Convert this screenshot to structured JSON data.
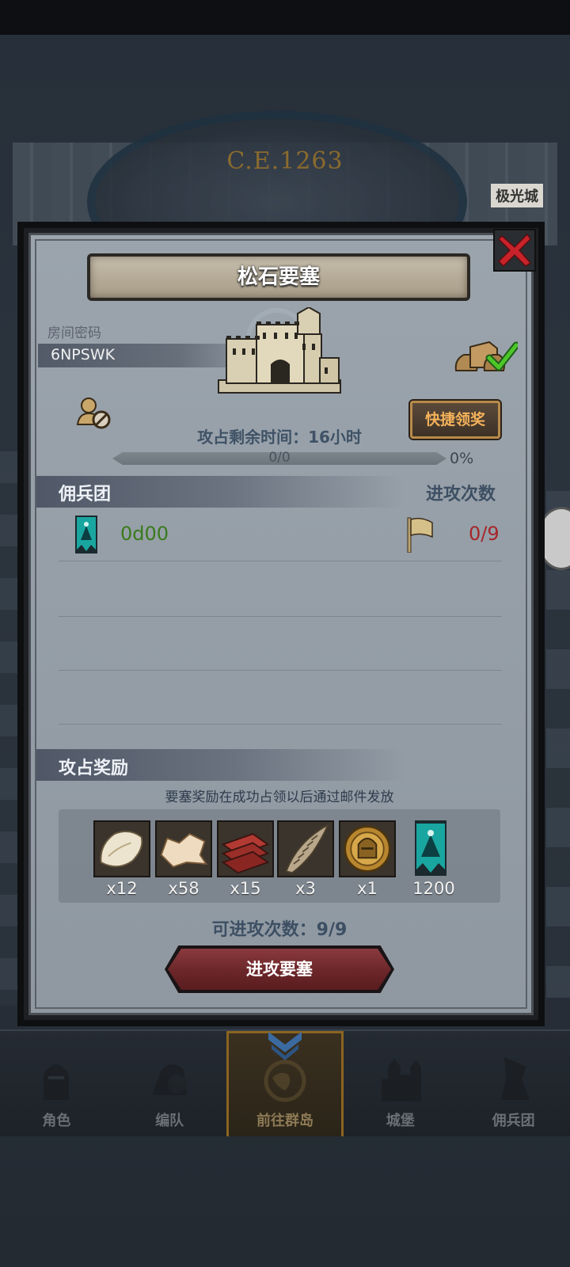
{
  "background": {
    "year_text": "C.E.1263",
    "place_label": "极光城"
  },
  "modal": {
    "title": "松石要塞",
    "room_code_label": "房间密码",
    "room_code": "6NPSWK",
    "quick_claim_label": "快捷领奖",
    "remaining_time": "攻占剩余时间：16小时",
    "progress": {
      "text": "0/0",
      "percent_text": "0%",
      "fraction": 0
    },
    "mercenary_header": "佣兵团",
    "attacks_header": "进攻次数",
    "mercenary_rows": [
      {
        "name": "0d00",
        "attack_count": "0/9"
      }
    ],
    "reward_header": "攻占奖励",
    "reward_note": "要塞奖励在成功占领以后通过邮件发放",
    "rewards": [
      {
        "icon": "fur-pelt-icon",
        "qty": "x12"
      },
      {
        "icon": "leather-hide-icon",
        "qty": "x58"
      },
      {
        "icon": "wood-planks-icon",
        "qty": "x15"
      },
      {
        "icon": "horn-icon",
        "qty": "x3"
      },
      {
        "icon": "knight-medal-icon",
        "qty": "x1"
      },
      {
        "icon": "guild-banner-icon",
        "qty": "1200"
      }
    ],
    "attack_times": "可进攻次数：9/9",
    "attack_button": "进攻要塞"
  },
  "nav": {
    "items": [
      {
        "label": "角色",
        "icon": "knight-helmet-icon"
      },
      {
        "label": "编队",
        "icon": "helmet-shield-icon"
      },
      {
        "label": "前往群岛",
        "icon": "globe-icon"
      },
      {
        "label": "城堡",
        "icon": "castle-icon"
      },
      {
        "label": "佣兵团",
        "icon": "mercenary-flag-icon"
      }
    ],
    "active_index": 2
  },
  "colors": {
    "modal_bg": "#959ea7",
    "title_text": "#ffffff",
    "guild_name": "#3a7a1c",
    "attack_count": "#a6262a",
    "quick_claim_text": "#f4b25a",
    "attack_button": "#6b2629"
  }
}
